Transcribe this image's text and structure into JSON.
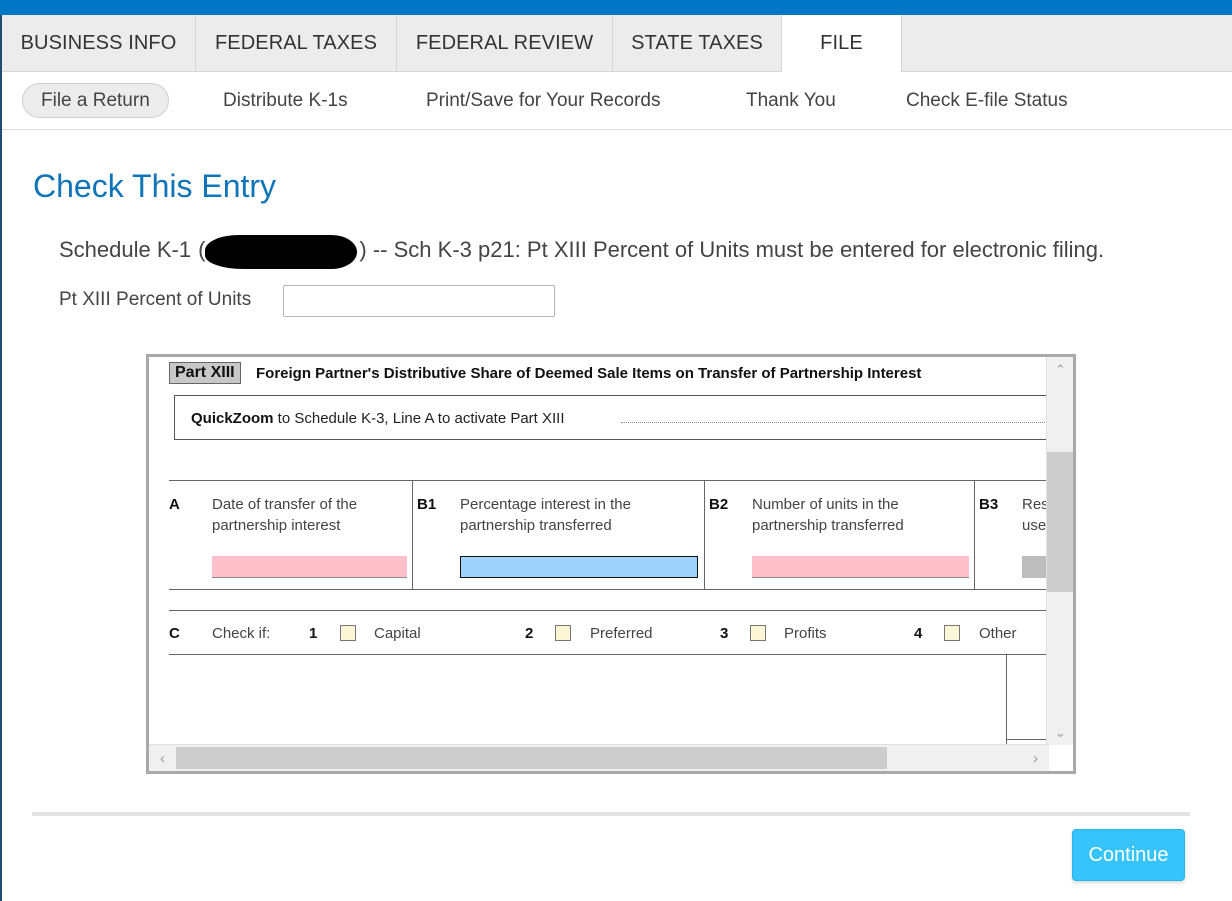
{
  "main_tabs": [
    {
      "label": "BUSINESS INFO"
    },
    {
      "label": "FEDERAL TAXES"
    },
    {
      "label": "FEDERAL REVIEW"
    },
    {
      "label": "STATE TAXES"
    },
    {
      "label": "FILE"
    }
  ],
  "sub_tabs": [
    {
      "label": "File a Return"
    },
    {
      "label": "Distribute K-1s"
    },
    {
      "label": "Print/Save for Your Records"
    },
    {
      "label": "Thank You"
    },
    {
      "label": "Check E-file Status"
    }
  ],
  "page_title": "Check This Entry",
  "message": {
    "prefix": "Schedule K-1",
    "open_paren": "(",
    "suffix": ") -- Sch K-3 p21: Pt XIII Percent of Units  must be entered for electronic filing."
  },
  "field": {
    "label": "Pt XIII Percent of Units",
    "value": ""
  },
  "form": {
    "part_badge": "Part XIII",
    "part_title": "Foreign Partner's Distributive Share of Deemed Sale Items on Transfer of Partnership Interest",
    "quickzoom_bold": "QuickZoom",
    "quickzoom_text": " to Schedule K-3, Line A to activate Part XIII",
    "col_a": {
      "letter": "A",
      "line1": "Date of transfer of the",
      "line2": "partnership interest"
    },
    "col_b1": {
      "letter": "B1",
      "line1": "Percentage interest in the",
      "line2": "partnership transferred"
    },
    "col_b2": {
      "letter": "B2",
      "line1": "Number of units in the",
      "line2": "partnership transferred"
    },
    "col_b3": {
      "letter": "B3",
      "line1": "Res",
      "line2": "use"
    },
    "row_c": {
      "letter": "C",
      "label": "Check if:",
      "options": [
        {
          "num": "1",
          "label": "Capital"
        },
        {
          "num": "2",
          "label": "Preferred"
        },
        {
          "num": "3",
          "label": "Profits"
        },
        {
          "num": "4",
          "label": "Other"
        }
      ]
    }
  },
  "continue_label": "Continue",
  "colors": {
    "brand": "#0077c5",
    "title": "#0f74b8",
    "continue": "#37c4fb",
    "pink_field": "#ffc0cb",
    "blue_field": "#9fd3fc"
  }
}
